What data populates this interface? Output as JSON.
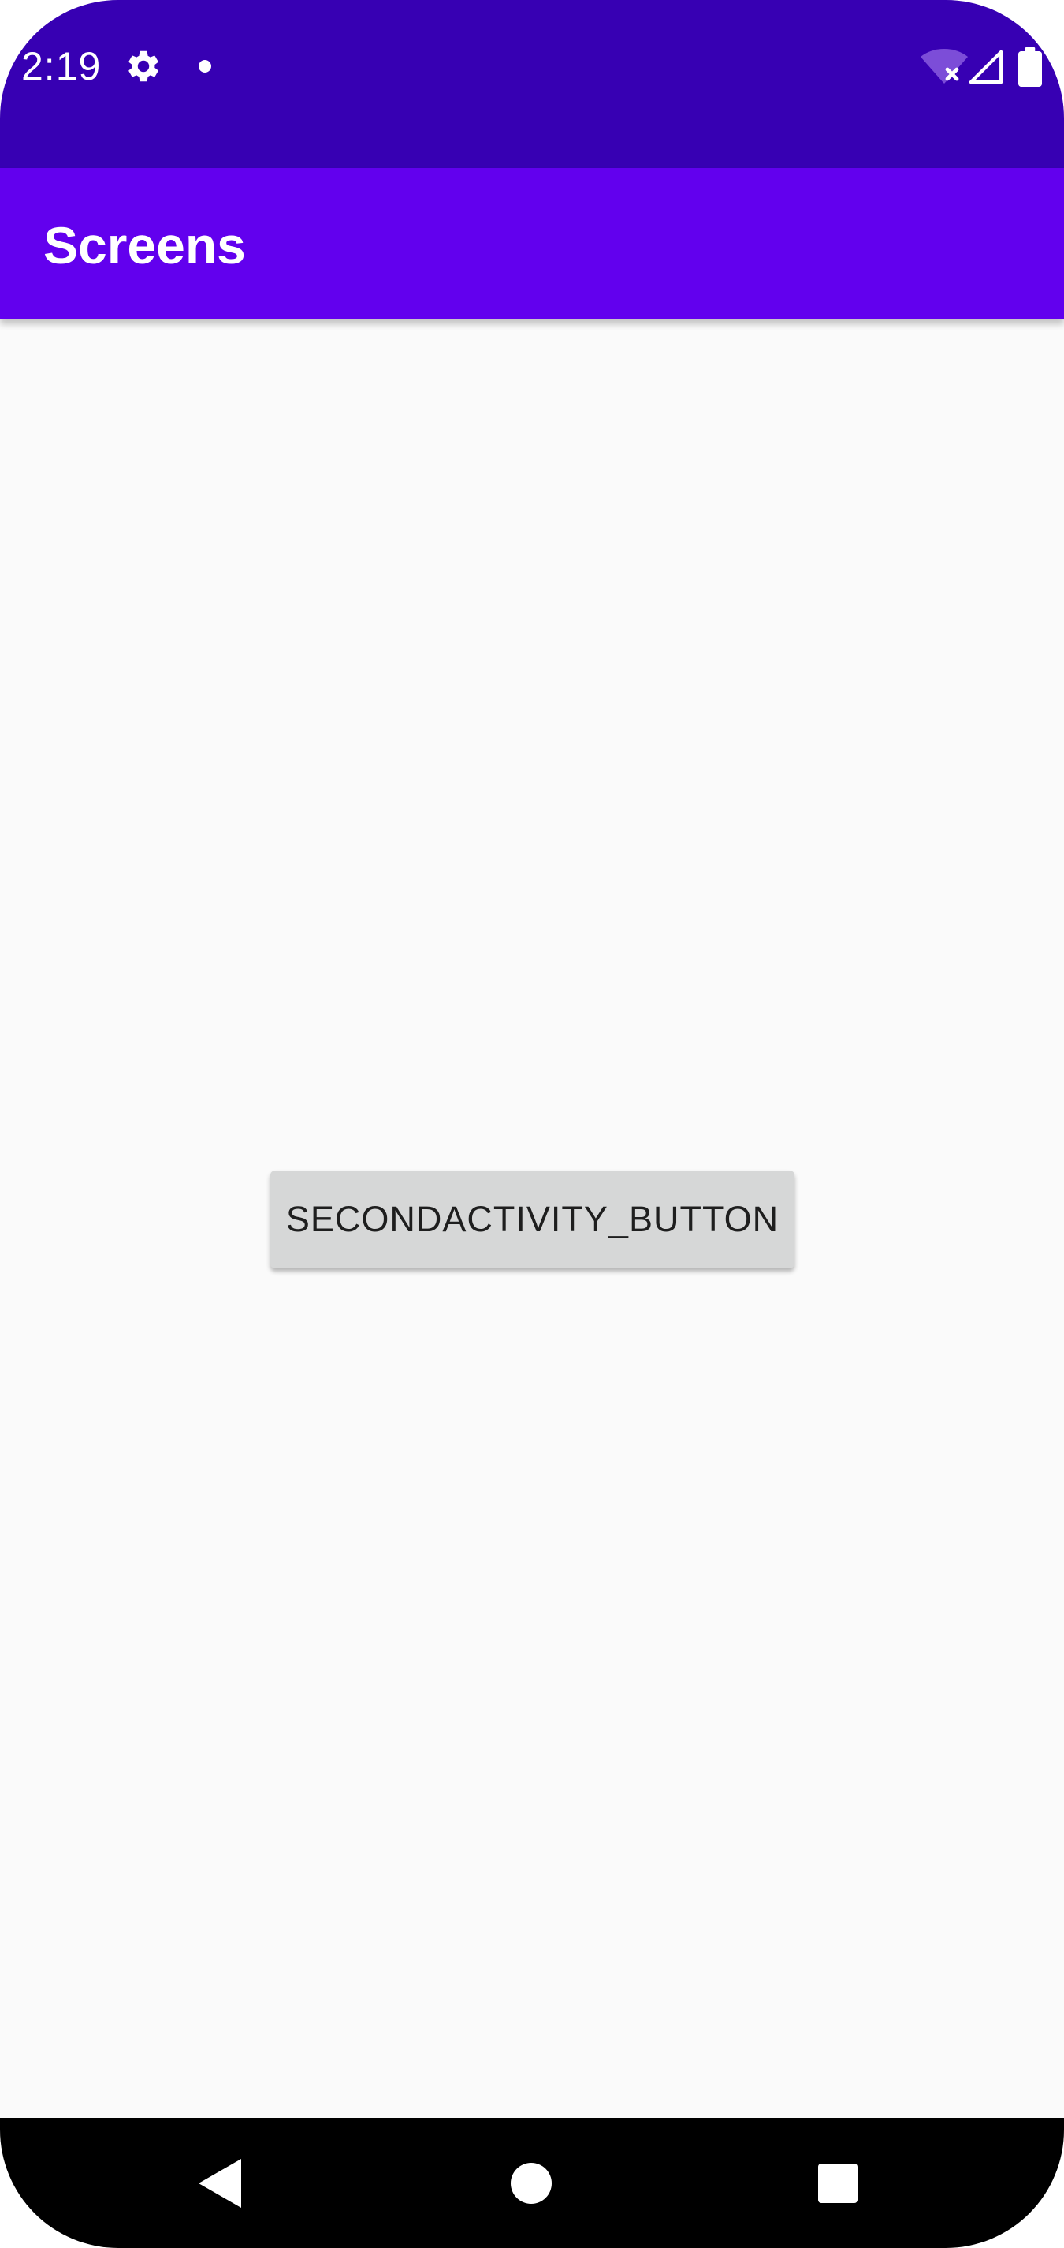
{
  "status_bar": {
    "time": "2:19",
    "icons": [
      "gear-icon",
      "notification-dot-icon",
      "wifi-off-icon",
      "cell-signal-icon",
      "battery-icon"
    ],
    "background_color": "#3700b3"
  },
  "app_bar": {
    "title": "Screens",
    "background_color": "#6200ee"
  },
  "main": {
    "button_label": "SECONDACTIVITY_BUTTON",
    "background_color": "#fafafa"
  },
  "nav_bar": {
    "icons": [
      "back-icon",
      "home-icon",
      "recents-icon"
    ],
    "background_color": "#000000"
  }
}
